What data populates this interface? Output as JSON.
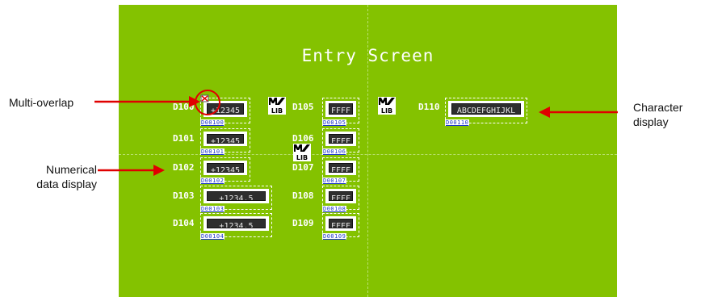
{
  "screen": {
    "title": "Entry Screen",
    "background_color": "#84c200",
    "labels": [
      "D100",
      "D101",
      "D102",
      "D103",
      "D104",
      "D105",
      "D106",
      "D107",
      "D108",
      "D109",
      "D110"
    ],
    "parts": [
      {
        "value": "+12345",
        "tag": "D00100"
      },
      {
        "value": "+12345",
        "tag": "D00101"
      },
      {
        "value": "+12345",
        "tag": "D00102"
      },
      {
        "value": "+1234.5",
        "tag": "D00103"
      },
      {
        "value": "+1234.5",
        "tag": "D00104"
      },
      {
        "value": "FFFF",
        "tag": "D00105"
      },
      {
        "value": "FFFF",
        "tag": "D00106"
      },
      {
        "value": "FFFF",
        "tag": "D00107"
      },
      {
        "value": "FFFF",
        "tag": "D00108"
      },
      {
        "value": "FFFF",
        "tag": "D00109"
      },
      {
        "value": "ABCDEFGHIJKL",
        "tag": "D00110"
      }
    ],
    "mlib_icon_text": "LIB"
  },
  "callouts": {
    "multi_overlap": "Multi-overlap",
    "numerical_data_display": "Numerical\ndata display",
    "character_display": "Character\ndisplay"
  },
  "colors": {
    "arrow": "#e00000",
    "marker_circle": "#e00000",
    "tag_text": "#1a35c8",
    "lcd": "#2e2e2e"
  }
}
